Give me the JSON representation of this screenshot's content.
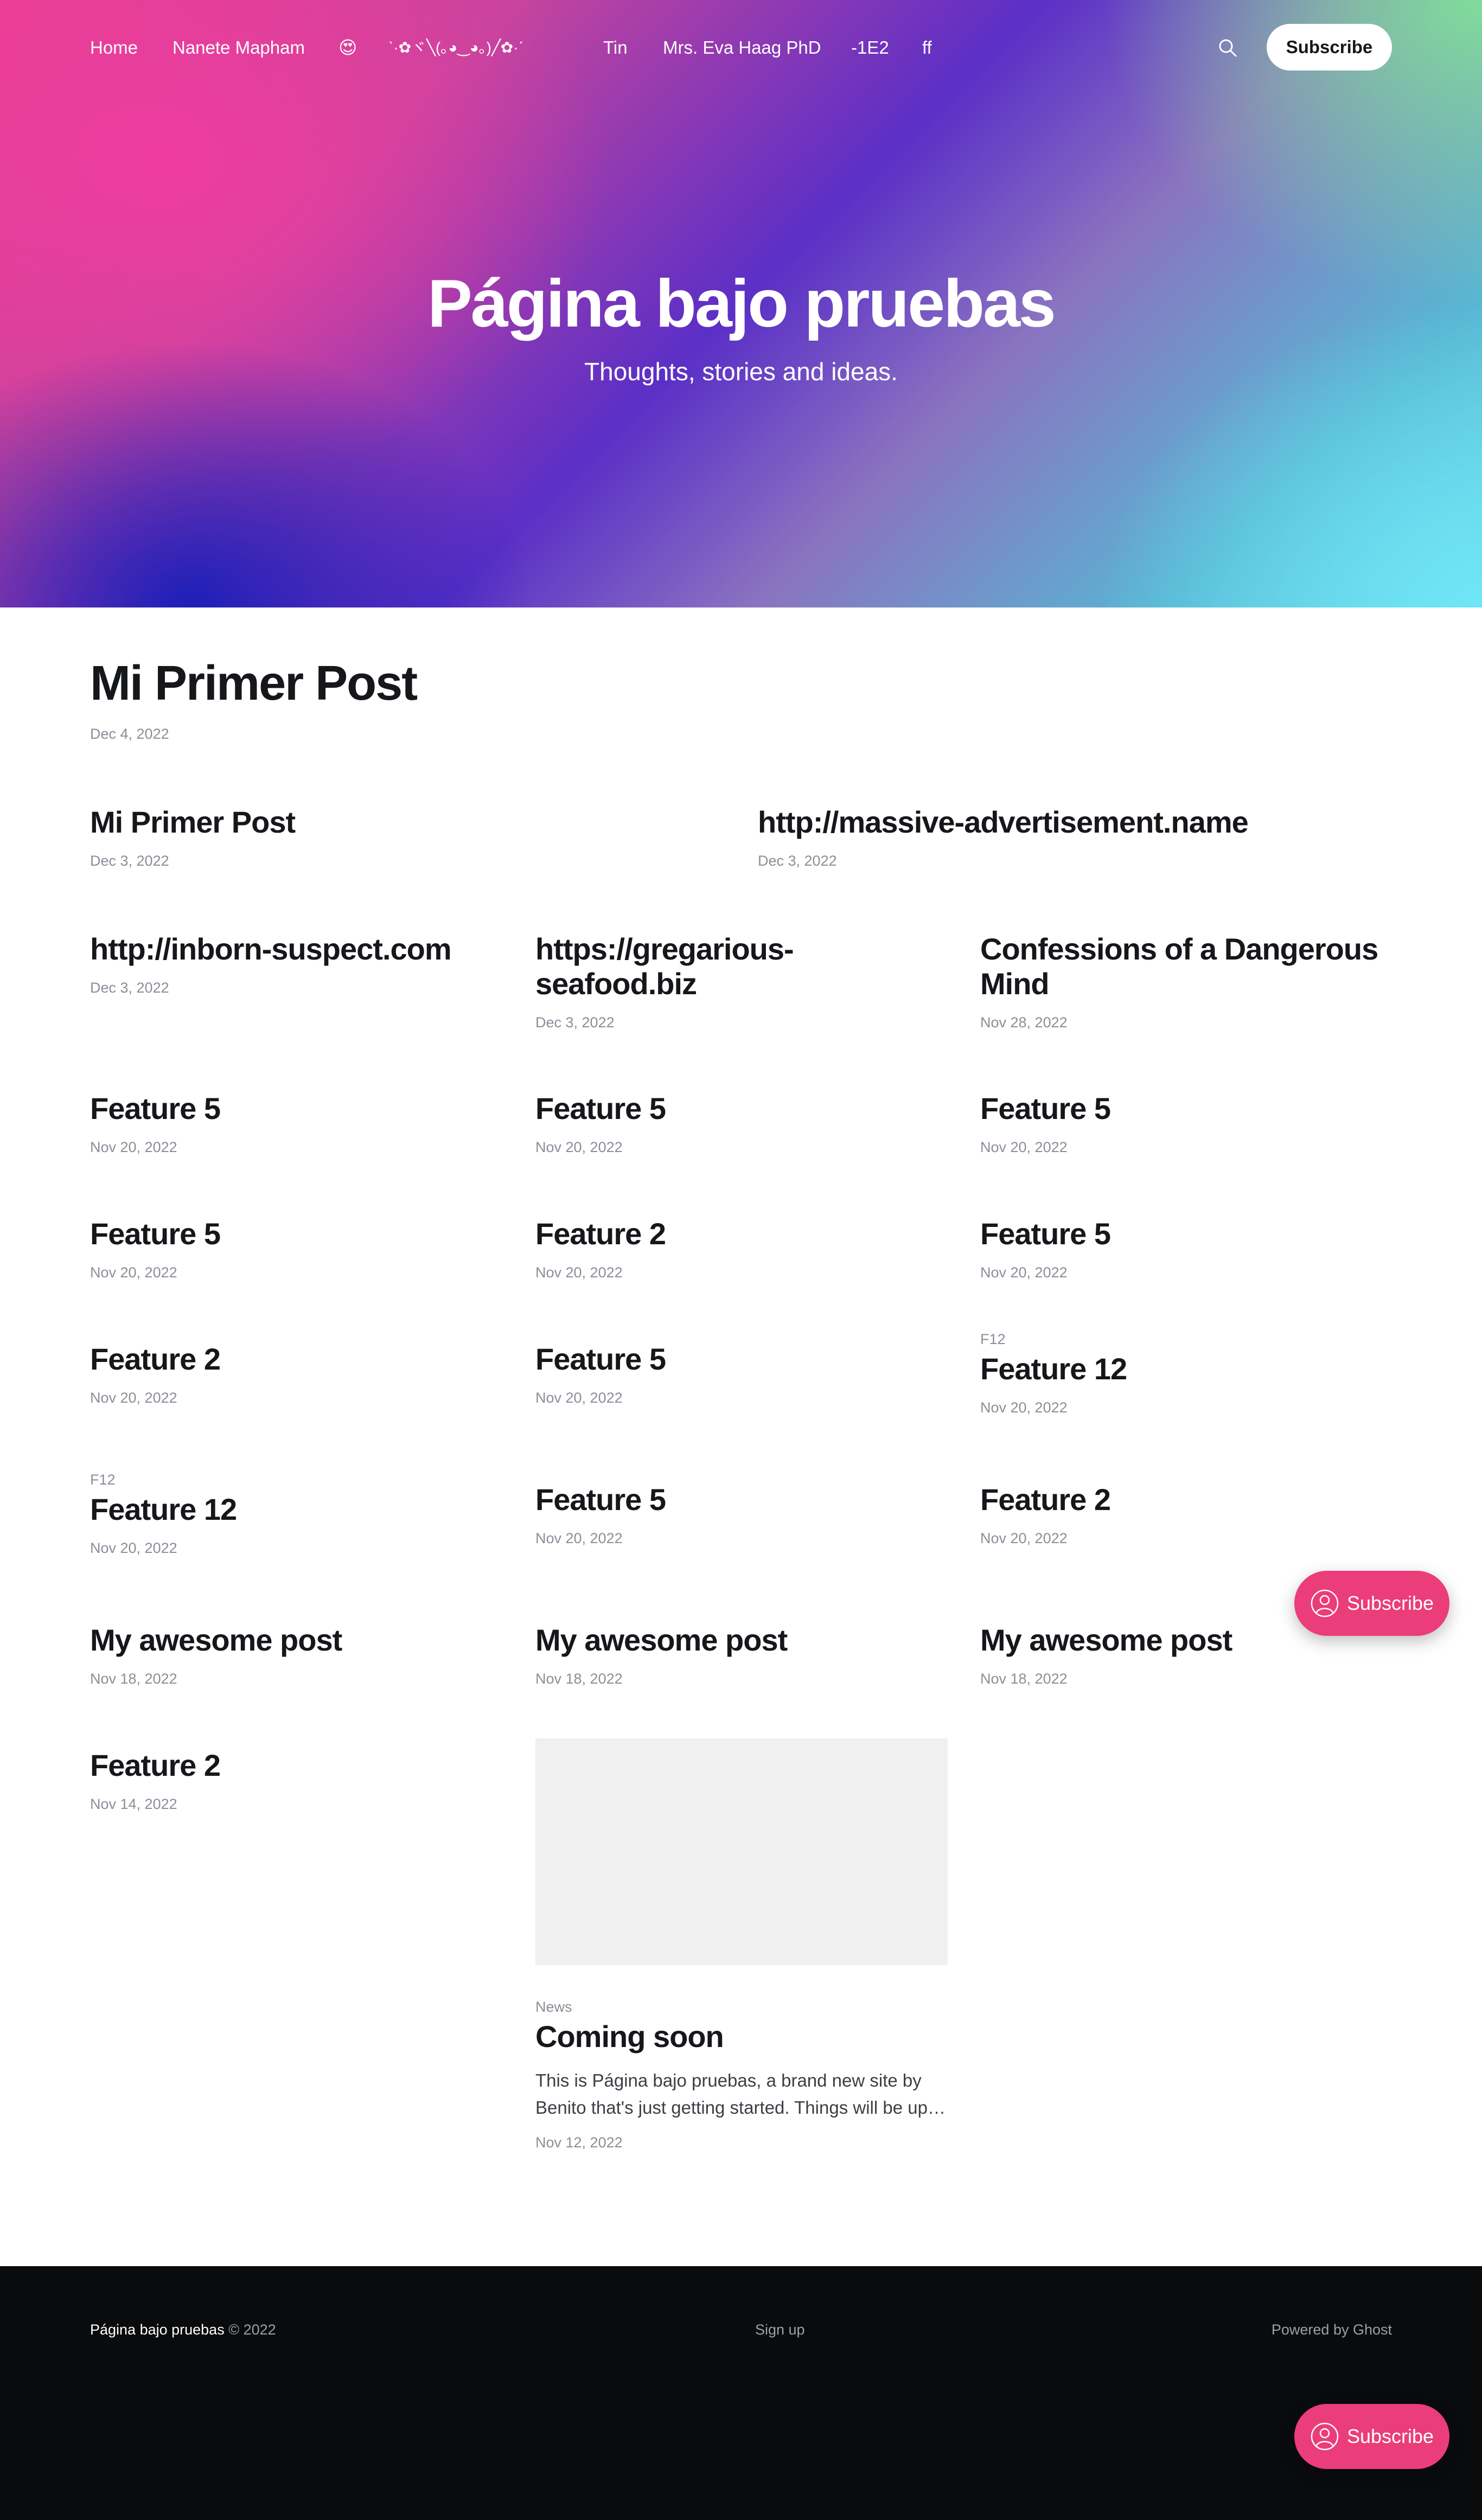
{
  "nav": {
    "items": [
      "Home",
      "Nanete Mapham",
      "😍",
      "ˋ·✿ヾ╲(｡◕‿◕｡)╱✿·ˊ",
      "Tin",
      "Mrs. Eva Haag PhD",
      "-1E2",
      "ff"
    ],
    "subscribe_label": "Subscribe",
    "search_icon": "search-icon"
  },
  "hero": {
    "title": "Página bajo pruebas",
    "subtitle": "Thoughts, stories and ideas."
  },
  "posts": [
    {
      "title": "Mi Primer Post",
      "date": "Dec 4, 2022"
    },
    {
      "title": "Mi Primer Post",
      "date": "Dec 3, 2022"
    },
    {
      "title": "http://massive-advertisement.name",
      "date": "Dec 3, 2022"
    },
    {
      "title": "http://inborn-suspect.com",
      "date": "Dec 3, 2022"
    },
    {
      "title": "https://gregarious-seafood.biz",
      "date": "Dec 3, 2022"
    },
    {
      "title": "Confessions of a Dangerous Mind",
      "date": "Nov 28, 2022"
    },
    {
      "title": "Feature 5",
      "date": "Nov 20, 2022"
    },
    {
      "title": "Feature 5",
      "date": "Nov 20, 2022"
    },
    {
      "title": "Feature 5",
      "date": "Nov 20, 2022"
    },
    {
      "title": "Feature 5",
      "date": "Nov 20, 2022"
    },
    {
      "title": "Feature 2",
      "date": "Nov 20, 2022"
    },
    {
      "title": "Feature 5",
      "date": "Nov 20, 2022"
    },
    {
      "title": "Feature 2",
      "date": "Nov 20, 2022"
    },
    {
      "title": "Feature 5",
      "date": "Nov 20, 2022"
    },
    {
      "tag": "F12",
      "title": "Feature 12",
      "date": "Nov 20, 2022"
    },
    {
      "tag": "F12",
      "title": "Feature 12",
      "date": "Nov 20, 2022"
    },
    {
      "title": "Feature 5",
      "date": "Nov 20, 2022"
    },
    {
      "title": "Feature 2",
      "date": "Nov 20, 2022"
    },
    {
      "title": "My awesome post",
      "date": "Nov 18, 2022"
    },
    {
      "title": "My awesome post",
      "date": "Nov 18, 2022"
    },
    {
      "title": "My awesome post",
      "date": "Nov 18, 2022"
    },
    {
      "title": "Feature 2",
      "date": "Nov 14, 2022"
    },
    {
      "tag": "News",
      "title": "Coming soon",
      "excerpt": "This is Página bajo pruebas, a brand new site by Benito that's just getting started. Things will be up…",
      "date": "Nov 12, 2022"
    }
  ],
  "footer": {
    "site": "Página bajo pruebas",
    "copyright": " © 2022",
    "signup": "Sign up",
    "powered": "Powered by Ghost"
  },
  "portal": {
    "label": "Subscribe",
    "icon": "user-circle-icon"
  },
  "colors": {
    "accent": "#ea3d79",
    "footer_bg": "#0a0b0c"
  }
}
